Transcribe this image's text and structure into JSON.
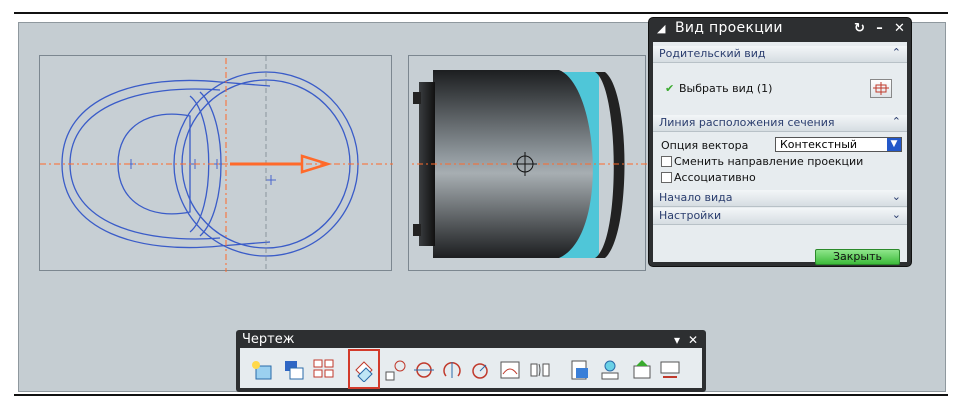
{
  "dialog": {
    "title": "Вид проекции",
    "parent_section": "Родительский вид",
    "select_view": "Выбрать вид (1)",
    "hinge_section": "Линия расположения сечения",
    "vector_option_label": "Опция вектора",
    "vector_option_value": "Контекстный",
    "reverse_direction": "Сменить направление проекции",
    "associative": "Ассоциативно",
    "view_origin": "Начало вида",
    "settings": "Настройки",
    "close": "Закрыть"
  },
  "toolbar": {
    "title": "Чертеж",
    "icons": [
      "base-view-icon",
      "view-from-part-icon",
      "projected-view-icon",
      "auxiliary-view-icon",
      "detail-view-icon",
      "section-view-icon",
      "half-section-icon",
      "revolved-section-icon",
      "pictorial-section-icon",
      "broken-view-icon",
      "update-view-icon",
      "view-label-icon",
      "view-dependent-edit-icon",
      "display-settings-icon"
    ]
  },
  "colors": {
    "accent": "#ff6a2a",
    "drawing_lines": "#3a5cc8",
    "ok_button": "#4fc44c"
  }
}
